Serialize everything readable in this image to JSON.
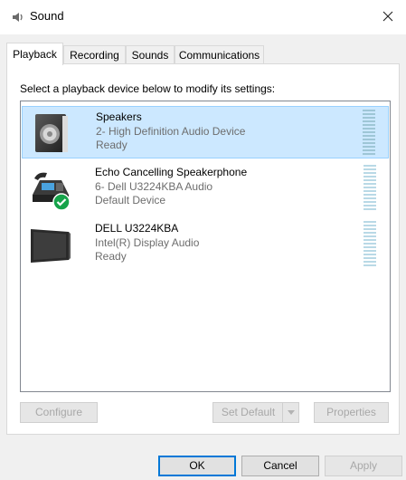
{
  "window": {
    "title": "Sound",
    "icon": "speaker-icon",
    "close_icon": "close-icon"
  },
  "tabs": [
    {
      "label": "Playback",
      "active": true
    },
    {
      "label": "Recording",
      "active": false
    },
    {
      "label": "Sounds",
      "active": false
    },
    {
      "label": "Communications",
      "active": false
    }
  ],
  "instruction": "Select a playback device below to modify its settings:",
  "devices": [
    {
      "name": "Speakers",
      "line1": "2- High Definition Audio Device",
      "line2": "Ready",
      "icon": "speaker-device-icon",
      "selected": true,
      "default": false
    },
    {
      "name": "Echo Cancelling Speakerphone",
      "line1": "6- Dell U3224KBA Audio",
      "line2": "Default Device",
      "icon": "speakerphone-device-icon",
      "selected": false,
      "default": true
    },
    {
      "name": "DELL U3224KBA",
      "line1": "Intel(R) Display Audio",
      "line2": "Ready",
      "icon": "monitor-device-icon",
      "selected": false,
      "default": false
    }
  ],
  "panel_buttons": {
    "configure": "Configure",
    "set_default": "Set Default",
    "properties": "Properties"
  },
  "dialog_buttons": {
    "ok": "OK",
    "cancel": "Cancel",
    "apply": "Apply"
  },
  "colors": {
    "selection_bg": "#cce8ff",
    "selection_border": "#99d1ff",
    "accent": "#0078d7",
    "default_check": "#16a34a"
  }
}
